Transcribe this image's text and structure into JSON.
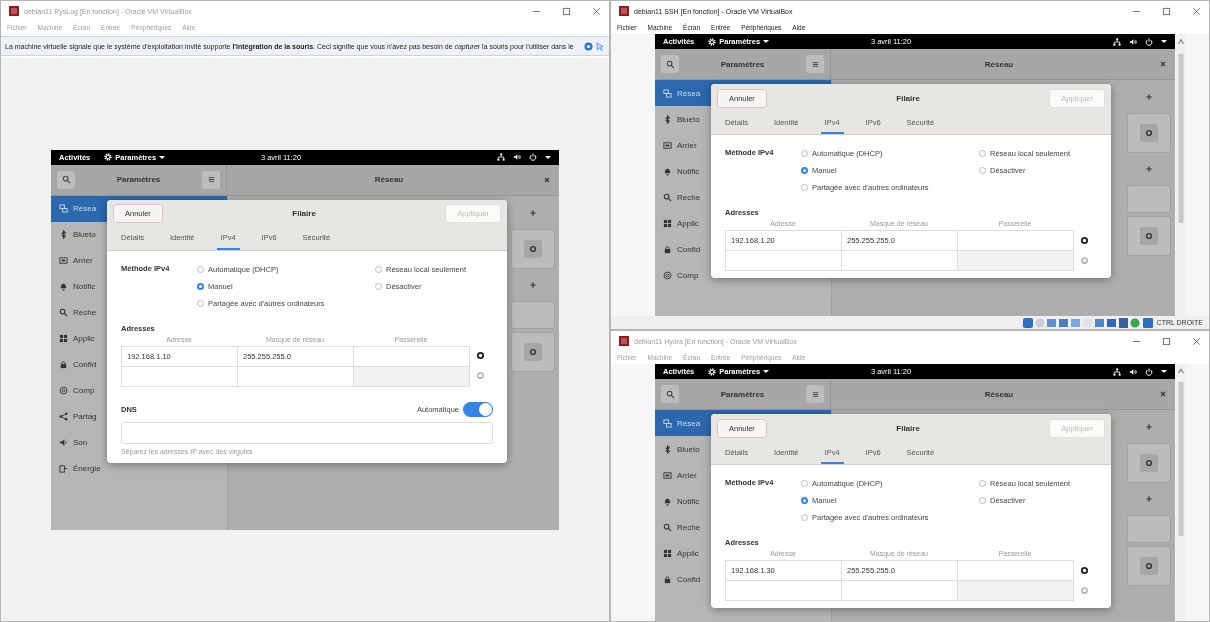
{
  "windows": [
    {
      "title": "debian11 RysLog [En fonction] - Oracle VM VirtualBox",
      "active": false,
      "menu": [
        "Fichier",
        "Machine",
        "Écran",
        "Entrée",
        "Périphériques",
        "Aide"
      ],
      "notice": "La machine virtuelle signale que le système d'exploitation invité supporte **l'intégration de la souris**. Ceci signifie que vous n'avez pas besoin de *capturer* la souris pour l'utiliser dans le",
      "vm": {
        "topbar": {
          "activities": "Activités",
          "app": "Paramètres",
          "clock": "3 avril 11:20"
        },
        "header": {
          "title": "Paramètres",
          "page": "Réseau"
        },
        "sidebar": [
          {
            "label": "Résea",
            "selected": true
          },
          {
            "label": "Blueto",
            "selected": false
          },
          {
            "label": "Arrier",
            "selected": false
          },
          {
            "label": "Notific",
            "selected": false
          },
          {
            "label": "Reche",
            "selected": false
          },
          {
            "label": "Applic",
            "selected": false
          },
          {
            "label": "Confid",
            "selected": false
          },
          {
            "label": "Comp",
            "selected": false
          },
          {
            "label": "Partag",
            "selected": false
          },
          {
            "label": "Son",
            "selected": false
          },
          {
            "label": "Énergie",
            "selected": false
          }
        ],
        "dialog": {
          "cancel": "Annuler",
          "title": "Filaire",
          "apply": {
            "label": "Appliquer",
            "disabled": true
          },
          "tabs": [
            {
              "label": "Détails",
              "selected": false
            },
            {
              "label": "Identité",
              "selected": false
            },
            {
              "label": "IPv4",
              "selected": true
            },
            {
              "label": "IPv6",
              "selected": false
            },
            {
              "label": "Sécurité",
              "selected": false
            }
          ],
          "method_label": "Méthode IPv4",
          "methods": [
            {
              "label": "Automatique (DHCP)",
              "selected": false
            },
            {
              "label": "Manuel",
              "selected": true
            },
            {
              "label": "Partagée avec d'autres ordinateurs",
              "selected": false
            },
            {
              "label": "Réseau local seulement",
              "selected": false
            },
            {
              "label": "Désactiver",
              "selected": false
            }
          ],
          "addresses_label": "Adresses",
          "columns": [
            "Adresse",
            "Masque de réseau",
            "Passerelle"
          ],
          "rows": [
            {
              "kind": "filled",
              "address": "192.168.1.10",
              "netmask": "255.255.255.0"
            },
            {
              "kind": "blank"
            }
          ],
          "dns": {
            "label": "DNS",
            "auto_label": "Automatique",
            "auto_on": true,
            "hint": "Séparez les adresses IP avec des virgules"
          }
        }
      }
    },
    {
      "title": "debian11 SSH [En fonction] - Oracle VM VirtualBox",
      "active": true,
      "menu": [
        "Fichier",
        "Machine",
        "Écran",
        "Entrée",
        "Périphériques",
        "Aide"
      ],
      "vm": {
        "topbar": {
          "activities": "Activités",
          "app": "Paramètres",
          "clock": "3 avril 11:20"
        },
        "header": {
          "title": "Paramètres",
          "page": "Réseau"
        },
        "sidebar": [
          {
            "label": "Résea",
            "selected": true
          },
          {
            "label": "Blueto",
            "selected": false
          },
          {
            "label": "Arrier",
            "selected": false
          },
          {
            "label": "Notific",
            "selected": false
          },
          {
            "label": "Reche",
            "selected": false
          },
          {
            "label": "Applic",
            "selected": false
          },
          {
            "label": "Confid",
            "selected": false
          },
          {
            "label": "Comp",
            "selected": false
          }
        ],
        "dialog": {
          "cancel": "Annuler",
          "title": "Filaire",
          "apply": {
            "label": "Appliquer",
            "disabled": true
          },
          "tabs": [
            {
              "label": "Détails",
              "selected": false
            },
            {
              "label": "Identité",
              "selected": false
            },
            {
              "label": "IPv4",
              "selected": true
            },
            {
              "label": "IPv6",
              "selected": false
            },
            {
              "label": "Sécurité",
              "selected": false
            }
          ],
          "method_label": "Méthode IPv4",
          "methods": [
            {
              "label": "Automatique (DHCP)",
              "selected": false
            },
            {
              "label": "Manuel",
              "selected": true
            },
            {
              "label": "Partagée avec d'autres ordinateurs",
              "selected": false
            },
            {
              "label": "Réseau local seulement",
              "selected": false
            },
            {
              "label": "Désactiver",
              "selected": false
            }
          ],
          "addresses_label": "Adresses",
          "columns": [
            "Adresse",
            "Masque de réseau",
            "Passerelle"
          ],
          "rows": [
            {
              "kind": "filled",
              "address": "192.168.1.20",
              "netmask": "255.255.255.0"
            },
            {
              "kind": "blank"
            }
          ]
        }
      },
      "status": "CTRL DROITE"
    },
    {
      "title": "debian11 Hydra [En fonction] - Oracle VM VirtualBox",
      "active": false,
      "menu": [
        "Fichier",
        "Machine",
        "Écran",
        "Entrée",
        "Périphériques",
        "Aide"
      ],
      "vm": {
        "topbar": {
          "activities": "Activités",
          "app": "Paramètres",
          "clock": "3 avril 11:20"
        },
        "header": {
          "title": "Paramètres",
          "page": "Réseau"
        },
        "sidebar": [
          {
            "label": "Résea",
            "selected": true
          },
          {
            "label": "Blueto",
            "selected": false
          },
          {
            "label": "Arrier",
            "selected": false
          },
          {
            "label": "Notific",
            "selected": false
          },
          {
            "label": "Reche",
            "selected": false
          },
          {
            "label": "Applic",
            "selected": false
          },
          {
            "label": "Confid",
            "selected": false
          }
        ],
        "dialog": {
          "cancel": "Annuler",
          "title": "Filaire",
          "apply": {
            "label": "Appliquer",
            "disabled": true
          },
          "tabs": [
            {
              "label": "Détails",
              "selected": false
            },
            {
              "label": "Identité",
              "selected": false
            },
            {
              "label": "IPv4",
              "selected": true
            },
            {
              "label": "IPv6",
              "selected": false
            },
            {
              "label": "Sécurité",
              "selected": false
            }
          ],
          "method_label": "Méthode IPv4",
          "methods": [
            {
              "label": "Automatique (DHCP)",
              "selected": false
            },
            {
              "label": "Manuel",
              "selected": true
            },
            {
              "label": "Partagée avec d'autres ordinateurs",
              "selected": false
            },
            {
              "label": "Réseau local seulement",
              "selected": false
            },
            {
              "label": "Désactiver",
              "selected": false
            }
          ],
          "addresses_label": "Adresses",
          "columns": [
            "Adresse",
            "Masque de réseau",
            "Passerelle"
          ],
          "rows": [
            {
              "kind": "filled",
              "address": "192.168.1.30",
              "netmask": "255.255.255.0"
            },
            {
              "kind": "blank"
            }
          ]
        }
      }
    }
  ]
}
